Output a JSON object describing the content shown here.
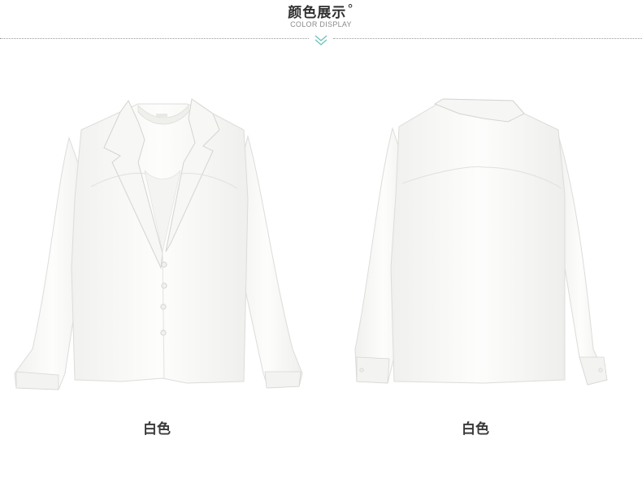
{
  "header": {
    "title": "颜色展示",
    "title_mark": "°",
    "subtitle": "COLOR DISPLAY",
    "divider_icon": "double-chevron-down-icon",
    "accent_color": "#6fc3bd"
  },
  "products": [
    {
      "view": "front",
      "color_label": "白色"
    },
    {
      "view": "back",
      "color_label": "白色"
    }
  ],
  "colors": {
    "shirt": "#fbfbfa",
    "shirt_shadow": "#ececea",
    "text": "#3a3a3a"
  }
}
